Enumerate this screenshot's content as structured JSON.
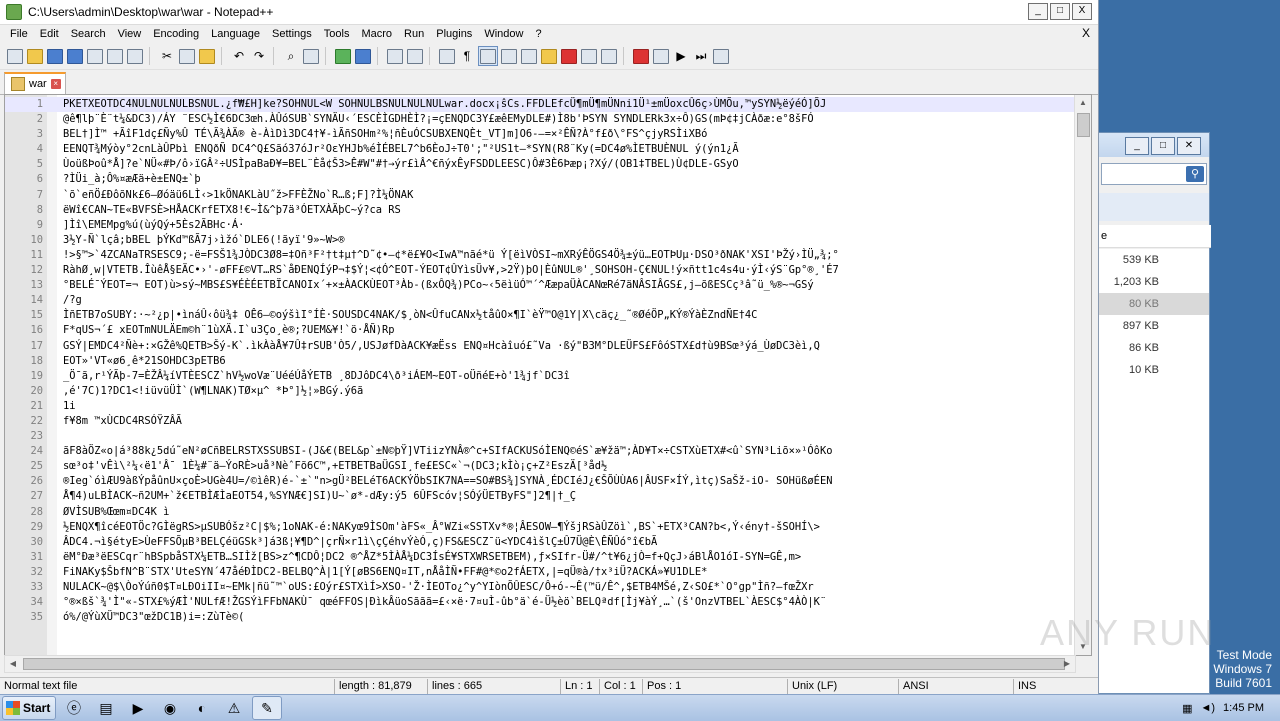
{
  "window": {
    "title": "C:\\Users\\admin\\Desktop\\war\\war - Notepad++",
    "min_label": "_",
    "max_label": "□",
    "close_label": "X"
  },
  "menu": {
    "items": [
      "File",
      "Edit",
      "Search",
      "View",
      "Encoding",
      "Language",
      "Settings",
      "Tools",
      "Macro",
      "Run",
      "Plugins",
      "Window",
      "?"
    ],
    "close_label": "X"
  },
  "tab": {
    "label": "war"
  },
  "editor": {
    "lines": [
      {
        "n": "1",
        "t": "PKETXEOTDC4NULNULNULBSNUL.¿f₩£H]ke?SOHNUL<W SOHNULBSNULNULNULwar.docx¡ŝCs.FFDLEfcÜ¶mÜ¶mÜNni1Ü¹±mÜoxcÛ6ç›ÙMÕu,™ySYN½ëýéÓ]ÕJ"
      },
      {
        "n": "2",
        "t": "@ê¶lþ¨È¨t¼&DC3)/ÁY ¨ESC½Ì€6DC3œh.ÀÛóSUB`SYNÄU‹´ESCÈÌGDHÈÌ?¡=çENQDC3Y£æêEMyDLE#)Ì8b'ÞSYN SYNDLERk3x÷Ô)GS(mÞ¢‡jCÀðæ:e°8šFÓ"
      },
      {
        "n": "3",
        "t": "BEL†]Ì™ +ÃîF1dç£Ñy%Û TÉ\\Ã¾ÀÄ®   è-ÀìDì3DC4†¥-ìÃñSOHm²%¦ñÈuÓCSUBXENQÈt_VT]m]O6-–=×²ÊÑ?À°f£ð\\°FS^çjyRSÌiXBó"
      },
      {
        "n": "4",
        "t": "EENQT¾Mýòy°2cnLàÛPbì ENQðÑ DC4^Q£Sãó37óJr²OεYHJb%éÌÉBEL7^b6ÈoJ÷T0';\"²US1t–*SYN(R8¨Ky(=DC4ø%ÌETBUÈNUL ý(ýn1¿Ã"
      },
      {
        "n": "5",
        "t": "ÙoüßÞoû*Å]?e`NÜ«#Þ/ô›ïGÂ²÷USÌpaBaÐ¥=BEL¨Èå¢Š3>Ê#W\"#†→ýr£ìÂ^€ñýxÊyFSDDLEESC)Ô#3È6Þæp¡?Xý/(OB1‡TBEL)Ù¢DLE-GSyO"
      },
      {
        "n": "6",
        "t": "?ÌÜi_à;Ô%¤æÆä+è±ENQ±`þ"
      },
      {
        "n": "7",
        "t": "`õ`eñÖ£ÐôõNk£6—Øóäü6LÌ‹>1kÖNAKLàU˝ž>FFÈŽNo`R…ß;F]?Ì¼ÖNAK"
      },
      {
        "n": "8",
        "t": "ëWî€CAN~TE«BVFSÈ>HÅACKrfETX8!€~Ì&^þ7ä³ÓETXÀÄþC~ý?ca RS"
      },
      {
        "n": "9",
        "t": "]Ìî\\EMEMpg%ú(ùýQý+5Ès2ÃBHc·Á·"
      },
      {
        "n": "10",
        "t": "3½Y-Ñ`lçâ;bBEL þÝKd™ßÃ7j›ìžó`DLE6(!ãyï'9»~W>®"
      },
      {
        "n": "11",
        "t": "!>§™>`4ZCANaTRSESC9;-ë=FSŠ1¾JÒDC3Ø8=‡Oñ³F²†t‡µ†^D˜¢•–¢*ë£¥O<IwA™nãé*ü Ý[ëìVÒSI~mXRýÊÖGS4Ö¾±ýü…EOTÞUµ·DSO³ðNAK'XSI'ÞŽý›ÌÜ„¾;°"
      },
      {
        "n": "12",
        "t": "RàhØ¸w|VTETB.ÎùêÅ§EÄC•›'-øFF£©VT…RS`åÐENQÍýP¬‡$Ý¦<¢Ó^EOT-ÝEOT¢ÛYìsÜv¥,>2Ÿ)þO|ÈûNUL®'¸SOHSOH-Ç€NUL!ý×ñtt1c4s4u·ýÌ‹ýS¨Gp°®¸'É7"
      },
      {
        "n": "13",
        "t": "°BELÉ¯ÝEOT=¬ EOT)ù>sý~MBS£S¥ÉÈÉETBÏCANOIx´+×±ÀACKÙEOT³Àb-(ßxÔQ¾)PCo~‹5ëìüÓ™´^ÆæpaÜÀCANœRé7äNÂSIÂGS£,j–õßESCç³â˜ü_%®~¬GSý"
      },
      {
        "n": "14",
        "t": "/?g"
      },
      {
        "n": "15",
        "t": "ÌñETB7oSUBY:·~²¿p|•ìnáÛ‹ôü¾‡ OÊ6–©oýšìI°ÍÈ·SOUSDC4NAK/$¸òN<ÛfuCANx½tåûO×¶I`èŸ™O@1Y|X\\cäç¿_˜®ØéÖP„KÝ®ÝàÈZndÑE†4C"
      },
      {
        "n": "16",
        "t": "F*qUS¬´£   xEOTmNULÄEm©h¨1ùXÄ.I`u3Ço¸è®;?UEM&¥!`ö·ÅÑ)Rp"
      },
      {
        "n": "17",
        "t": "GSÝ|EMDC4²Ñè+:×GŽê%QETB>Šý-K`.ìkÀàÅ¥7Û‡rSUB'Ò5/,USJøfDàACK¥æËss ENQ¤Hcàîuó£˜Va  ·ßý\"B3M°DLEÜFS£FôóSTX£d†ù9BSœ³ýá_ÙøDC3èì,Q"
      },
      {
        "n": "18",
        "t": "EOT»'VT«ø6¸ê*21SOHDC3pETB6"
      },
      {
        "n": "19",
        "t": "_Ö¯ã,r¹ÝÃþ-7=ÈŽÂ¼íVTÈESCZ`hV½woVæ¨UééÚåÝETB ¸8DJôDC4\\ð³iÁEM~EOT-oÜñéE+ò'1¾jf`DC3î"
      },
      {
        "n": "20",
        "t": ",é'7C)1?DC1<!iüvüÜÌ`(W¶LNAK)TØ×µ^  *Þ°]½¦»BGý.ý6ã"
      },
      {
        "n": "21",
        "t": "1i"
      },
      {
        "n": "22",
        "t": "f¥8m    ™xÙCDC4RSÓŸZÂÃ"
      },
      {
        "n": "23",
        "t": ""
      },
      {
        "n": "24",
        "t": "ãF8àÖZ«o|á³88k¿5dú˜eN²øCñBELRSTXSSUBSI-(J&€(BEL&p`±N©þŸ]VTiizYNÂ®^c+SIfACKUSóÌENQ©éS`æ¥žä™;ÀD¥T×÷CSTXùETX#<û`SYN³Liõ×»¹ÓôKo"
      },
      {
        "n": "25",
        "t": "sœ³o‡'vÊì\\²¼‹ë1'Â¯ 1È¼#¨ä–ÝoRÈ>uå³NèˆFõ6C™,+ETBETBaÜGSI¸fe£ESC«`¬(DC3;kÌò¡ç+Z²EszÄ[³åd½"
      },
      {
        "n": "26",
        "t": "®Ieg`óìÆU9àßÝpåûnU×çoÈ>UGè4U=/©ìêR)é-`±`\"n>gÜ²BELéT6ACKÝÖbSIK7NA==SO#BS¾]SYNÀ¸ÉDCIéJ¿€ŠÕÙÙA6|ÂUSF×ÍÝ,ìtç)SaŠž-iO- SOHüßøÉEN"
      },
      {
        "n": "27",
        "t": "Å¶4)uLBÌACK~ñ2UM+`ž€ETBÌÆÌaEOT54,%SYNÆ€]SI)U~`ø*-dÆy:ý5    6ÛFScóv¦SÓýÜETByFS\"]2¶|†_Ç"
      },
      {
        "n": "28",
        "t": "ØVÌSUB%Œœm¤DC4K    ì"
      },
      {
        "n": "29",
        "t": "½ENQX¶îcéEOTÖc?GÌëgRS>µSUBÓšz²C|$%;1oNAK-é:NAKyœ9ÌSOm'àFS«_Â°WZi«SSTXv*®¦ÂESOW–¶ÝšjRSàÛZöì`,BS`+ETX³CAN?b<,Ý‹ény†-šSOHÍ\\>"
      },
      {
        "n": "30",
        "t": "ÂDC4.¬ì§étyE>ÙeFFSÕµB³BELÇéüGSk³]á3ß¦¥¶D^|çrÑ×r1ì\\çÇéhvÝèÓ,ç)FS&ESCZ¯ü<YDC4ìšlÇ±Û7Ü@È\\ÊÑÛó°î€bÃ"
      },
      {
        "n": "31",
        "t": "ëM°Ðæ³ëESCqr¨hBSpbåSTX¼ETB…SIÌž[BS>z^¶CDÔ¦DC2    ®^ÅZ*5ÌÀÅ¼DC3ÍsÉ¥STXWRSETBEM),ƒ×SIfr-Ü#/^t¥6¿jÒ=f+QçJ›áBlÅO1óI-SYN=GÊ,m>"
      },
      {
        "n": "32",
        "t": "FiNAKy$ŠbfN^B¨STX'UteSYN´47åéÐÌDC2-BELBQ^À|1[Ý[øBS6ENQ¤IT,nÅåÌÑ•FF#@*©o2fÁETX,|=qÜ®à/†x³iÜ?ACKÁ»¥U1DLE*"
      },
      {
        "n": "33",
        "t": "NULACK~@$\\ÒoÝúñ0$T¤LÐOiII¤~EMk|ñü˜™`oUS:£Oýr£STXìÍ>XSO-'Ž·ÌEOTo¿^y^YIònÕÛESC/Ô+ó-~Ê(™ü/Ê^,$ETB4MŠé,Z‹SO£*`O°gp\"Ìñ?–fœŽXr"
      },
      {
        "n": "34",
        "t": "°®×ßš`¾'Ì\"«-STX£%ýÆÌ'NULfÆ!ŽGSÝìFFbNAKÙ¯ qœéFFOS|ÐìkÂüoSããã=£‹×ë·7¤uÌ-ûb°ä`é-Ü½èö`BELQªdf[Ìj¥àÝ¸…`(š'OnzVTBEL`ÀESC$°4ÀÒ|K¨"
      },
      {
        "n": "35",
        "t": "ó%/@ÝùXÜ™DC3\"œžDC1B)i=:ZùTè©("
      }
    ]
  },
  "status": {
    "filetype": "Normal text file",
    "length": "length : 81,879",
    "lines": "lines : 665",
    "ln": "Ln : 1",
    "col": "Col : 1",
    "pos": "Pos : 1",
    "eol": "Unix (LF)",
    "encoding": "ANSI",
    "mode": "INS"
  },
  "bg_window": {
    "column_label": "e",
    "sizes": [
      "539 KB",
      "1,203 KB",
      "80 KB",
      "897 KB",
      "86 KB",
      "10 KB"
    ],
    "selected_index": 2
  },
  "watermark": {
    "text": "ANY RUN"
  },
  "testmode": {
    "line1": "Test Mode",
    "line2": "Windows 7",
    "line3": "Build 7601"
  },
  "taskbar": {
    "start_label": "Start",
    "time": "1:45 PM"
  }
}
